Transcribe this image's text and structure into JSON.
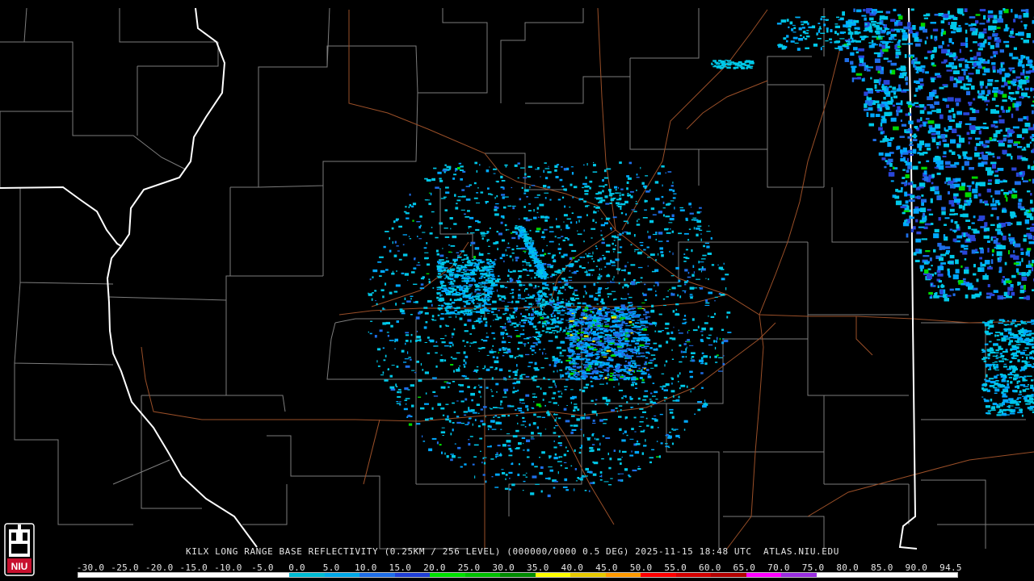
{
  "product": {
    "radar_site": "KILX",
    "caption": "KILX LONG RANGE BASE REFLECTIVITY (0.25KM / 256 LEVEL) (000000/0000 0.5 DEG) 2025-11-15 18:48 UTC  ATLAS.NIU.EDU"
  },
  "logo": {
    "text": "NIU",
    "icon": "niu-tower-logo-icon",
    "colors": {
      "red": "#c8102e",
      "white": "#ffffff"
    }
  },
  "color_scale": {
    "unit_values": [
      "-30.0",
      "-25.0",
      "-20.0",
      "-15.0",
      "-10.0",
      "-5.0",
      "0.0",
      "5.0",
      "10.0",
      "15.0",
      "20.0",
      "25.0",
      "30.0",
      "35.0",
      "40.0",
      "45.0",
      "50.0",
      "55.0",
      "60.0",
      "65.0",
      "70.0",
      "75.0",
      "80.0",
      "85.0",
      "90.0",
      "94.5"
    ],
    "colors": [
      "#ffffff",
      "#ffffff",
      "#ffffff",
      "#ffffff",
      "#ffffff",
      "#ffffff",
      "#00bcd4",
      "#00a8e8",
      "#1e6ee8",
      "#1f3fd6",
      "#00e000",
      "#00c000",
      "#008c00",
      "#ffff00",
      "#e6c800",
      "#ff9900",
      "#ff0000",
      "#d40000",
      "#b40000",
      "#ff00ff",
      "#9a2fe0",
      "#ffffff",
      "#ffffff",
      "#ffffff",
      "#ffffff"
    ]
  },
  "map_colors": {
    "background": "#000000",
    "county_lines": "#7d7d7d",
    "state_lines": "#ffffff",
    "roads": "#9a4f28",
    "radar_site_dot": "#000000"
  },
  "radar_palette": [
    "#00c8e8",
    "#00a8ff",
    "#1e6ee8",
    "#2a45d8",
    "#00d800",
    "#e6e600"
  ]
}
